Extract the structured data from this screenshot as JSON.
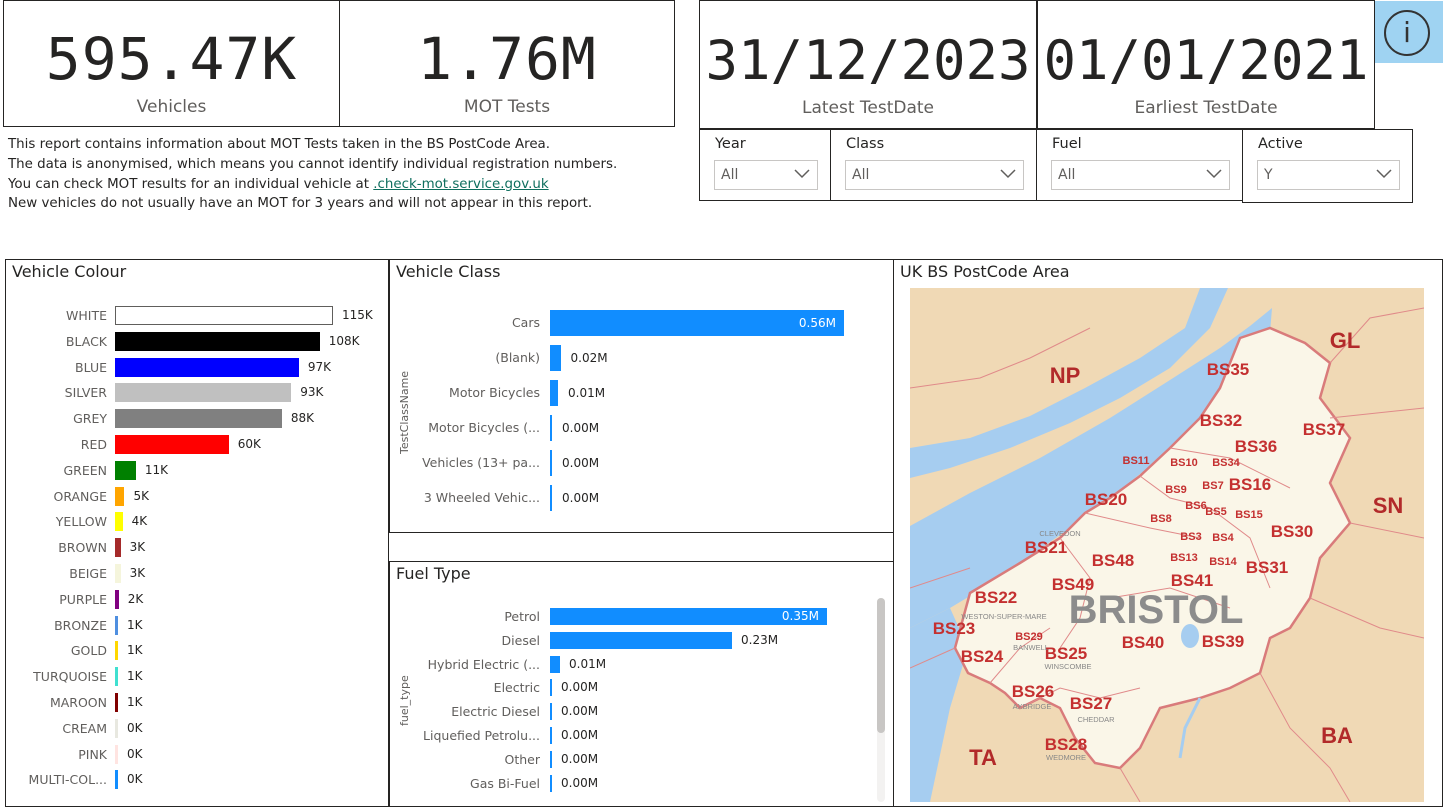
{
  "kpis": [
    {
      "value": "595.47K",
      "label": "Vehicles"
    },
    {
      "value": "1.76M",
      "label": "MOT Tests"
    },
    {
      "value": "31/12/2023",
      "label": "Latest TestDate"
    },
    {
      "value": "01/01/2021",
      "label": "Earliest TestDate"
    }
  ],
  "info_text": {
    "line1": "This report contains information about MOT Tests taken in the BS PostCode Area.",
    "line2": "The data is anonymised, which means you cannot identify individual registration numbers.",
    "line3_prefix": "You can check MOT results for an individual vehicle at ",
    "line3_link": ".check-mot.service.gov.uk",
    "line4": "New vehicles do not usually have an MOT for 3 years and will not appear in this report."
  },
  "slicers": [
    {
      "title": "Year",
      "value": "All"
    },
    {
      "title": "Class",
      "value": "All"
    },
    {
      "title": "Fuel",
      "value": "All"
    },
    {
      "title": "Active",
      "value": "Y"
    }
  ],
  "info_button": {
    "label": "i",
    "icon": "info-icon"
  },
  "colour_chart": {
    "title": "Vehicle Colour",
    "chart_data": {
      "type": "bar",
      "orientation": "horizontal",
      "categories": [
        "WHITE",
        "BLACK",
        "BLUE",
        "SILVER",
        "GREY",
        "RED",
        "GREEN",
        "ORANGE",
        "YELLOW",
        "BROWN",
        "BEIGE",
        "PURPLE",
        "BRONZE",
        "GOLD",
        "TURQUOISE",
        "MAROON",
        "CREAM",
        "PINK",
        "MULTI-COL..."
      ],
      "values": [
        115,
        108,
        97,
        93,
        88,
        60,
        11,
        5,
        4,
        3,
        3,
        2,
        1,
        1,
        1,
        1,
        0,
        0,
        0
      ],
      "value_labels": [
        "115K",
        "108K",
        "97K",
        "93K",
        "88K",
        "60K",
        "11K",
        "5K",
        "4K",
        "3K",
        "3K",
        "2K",
        "1K",
        "1K",
        "1K",
        "1K",
        "0K",
        "0K",
        "0K"
      ],
      "colors": [
        "#ffffff",
        "#000000",
        "#0000ff",
        "#c0c0c0",
        "#808080",
        "#ff0000",
        "#008000",
        "#ffa500",
        "#ffff00",
        "#a52a2a",
        "#f5f5dc",
        "#800080",
        "#4f8fe0",
        "#ffd700",
        "#40e0d0",
        "#800000",
        "#e8e8e0",
        "#ffe4e1",
        "#118dff"
      ]
    }
  },
  "class_chart": {
    "title": "Vehicle Class",
    "chart_data": {
      "type": "bar",
      "orientation": "horizontal",
      "ylabel": "TestClassName",
      "categories": [
        "Cars",
        "(Blank)",
        "Motor Bicycles",
        "Motor Bicycles (...",
        "Vehicles (13+ pa...",
        "3 Wheeled Vehic..."
      ],
      "values": [
        0.56,
        0.02,
        0.01,
        0.0,
        0.0,
        0.0
      ],
      "value_labels": [
        "0.56M",
        "0.02M",
        "0.01M",
        "0.00M",
        "0.00M",
        "0.00M"
      ]
    }
  },
  "fuel_chart": {
    "title": "Fuel Type",
    "chart_data": {
      "type": "bar",
      "orientation": "horizontal",
      "ylabel": "fuel_type",
      "categories": [
        "Petrol",
        "Diesel",
        "Hybrid Electric (...",
        "Electric",
        "Electric Diesel",
        "Liquefied Petrolu...",
        "Other",
        "Gas Bi-Fuel"
      ],
      "values": [
        0.35,
        0.23,
        0.01,
        0.0,
        0.0,
        0.0,
        0.0,
        0.0
      ],
      "value_labels": [
        "0.35M",
        "0.23M",
        "0.01M",
        "0.00M",
        "0.00M",
        "0.00M",
        "0.00M",
        "0.00M"
      ]
    }
  },
  "map": {
    "title": "UK BS PostCode Area",
    "city": "BRISTOL",
    "neighbours": [
      "NP",
      "GL",
      "SN",
      "BA",
      "TA"
    ],
    "districts": [
      "BS35",
      "BS32",
      "BS36",
      "BS37",
      "BS11",
      "BS10",
      "BS34",
      "BS9",
      "BS7",
      "BS16",
      "BS20",
      "BS6",
      "BS8",
      "BS5",
      "BS15",
      "BS21",
      "BS3",
      "BS4",
      "BS30",
      "BS48",
      "BS13",
      "BS14",
      "BS41",
      "BS31",
      "BS49",
      "BS22",
      "BS23",
      "BS29",
      "BS24",
      "BS25",
      "BS40",
      "BS39",
      "BS26",
      "BS27",
      "BS28"
    ],
    "towns": [
      "CLEVEDON",
      "WESTON-SUPER-MARE",
      "BANWELL",
      "WINSCOMBE",
      "AXBRIDGE",
      "CHEDDAR",
      "WEDMORE"
    ]
  }
}
